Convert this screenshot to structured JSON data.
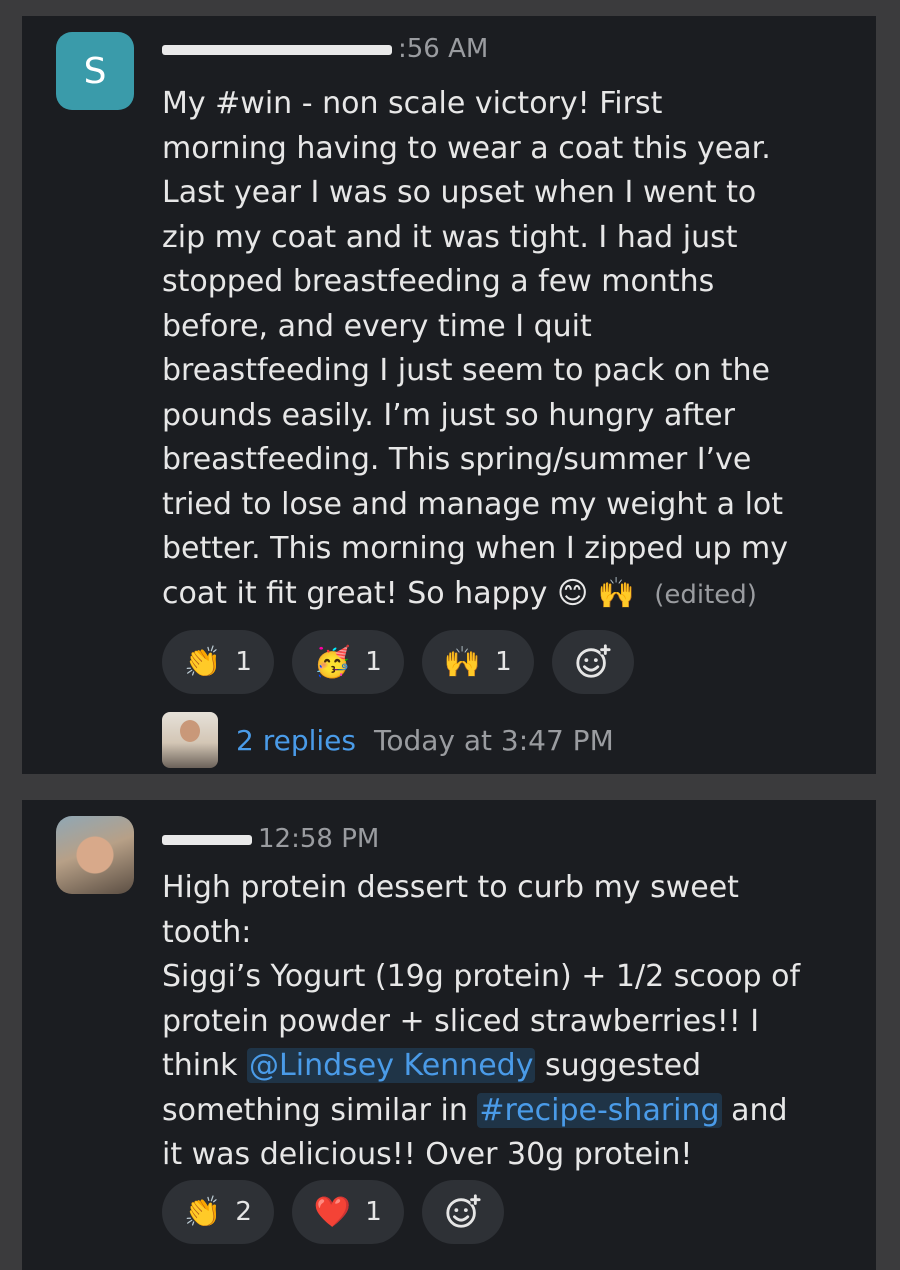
{
  "messages": [
    {
      "avatar_letter": "S",
      "avatar_color": "#3a9baa",
      "time": ":56 AM",
      "text": "My #win - non scale victory! First\nmorning having to wear a coat this year.\nLast year I was so upset when I went to\nzip my coat and it was tight. I had just\nstopped breastfeeding a few months\nbefore, and every time I quit\nbreastfeeding I just seem to pack on the\npounds easily. I’m just so hungry after\nbreastfeeding. This spring/summer I’ve\ntried to lose and manage my weight a lot\nbetter. This morning when I zipped up my\ncoat it fit great! So happy ",
      "inline_emojis": [
        "😊",
        "🙌"
      ],
      "edited": "(edited)",
      "reactions": [
        {
          "emoji": "👏",
          "count": "1"
        },
        {
          "emoji": "🥳",
          "count": "1"
        },
        {
          "emoji": "🙌",
          "count": "1"
        }
      ],
      "add_reaction_icon": "add-emoji-icon",
      "thread": {
        "replies": "2 replies",
        "time": "Today at 3:47 PM"
      }
    },
    {
      "time": "12:58 PM",
      "text_part1": "High protein dessert to curb my sweet\ntooth:\nSiggi’s Yogurt (19g protein) + 1/2 scoop of\nprotein powder + sliced strawberries!! I\nthink ",
      "mention": "@Lindsey Kennedy",
      "text_part2": " suggested\nsomething similar in ",
      "channel": "#recipe-sharing",
      "text_part3": " and\nit was delicious!! Over 30g protein!",
      "reactions": [
        {
          "emoji": "👏",
          "count": "2"
        },
        {
          "emoji": "❤️",
          "count": "1"
        }
      ],
      "add_reaction_icon": "add-emoji-icon"
    }
  ],
  "colors": {
    "background": "#3b3b3d",
    "card": "#1b1d21",
    "link": "#4a9be8",
    "pill": "#2e3136"
  }
}
